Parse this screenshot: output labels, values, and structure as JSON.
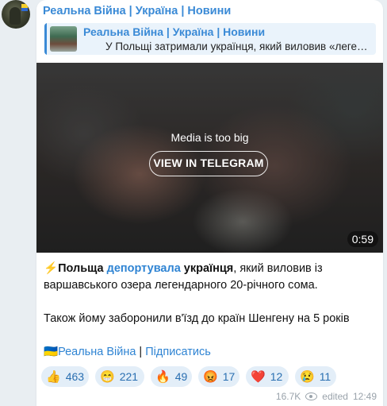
{
  "channel": {
    "title": "Реальна Війна | Україна | Новини"
  },
  "reply": {
    "title": "Реальна Війна | Україна | Новини",
    "text": "У Польщі затримали українця, який виловив «легендарного» сома"
  },
  "media": {
    "notice": "Media is too big",
    "button": "VIEW IN TELEGRAM",
    "duration": "0:59"
  },
  "post": {
    "emoji_lightning": "⚡",
    "p1_a": "Польща",
    "p1_b": "депортувала",
    "p1_c": "українця",
    "p1_d": ", який виловив із варшавського озера легендарного 20-річного сома.",
    "p2": "Також йому заборонили в'їзд до країн Шенгену на 5 років",
    "flag": "🇺🇦",
    "footer_channel": "Реальна Війна",
    "footer_sep": " | ",
    "footer_subscribe": "Підписатись"
  },
  "reactions": [
    {
      "emoji": "👍",
      "count": "463"
    },
    {
      "emoji": "😁",
      "count": "221"
    },
    {
      "emoji": "🔥",
      "count": "49"
    },
    {
      "emoji": "😡",
      "count": "17"
    },
    {
      "emoji": "❤️",
      "count": "12"
    },
    {
      "emoji": "😢",
      "count": "11"
    }
  ],
  "meta": {
    "views": "16.7K",
    "edited": "edited",
    "time": "12:49"
  },
  "colors": {
    "accent": "#3a8ad6",
    "bubble": "#ffffff",
    "background": "#e9eef2"
  }
}
